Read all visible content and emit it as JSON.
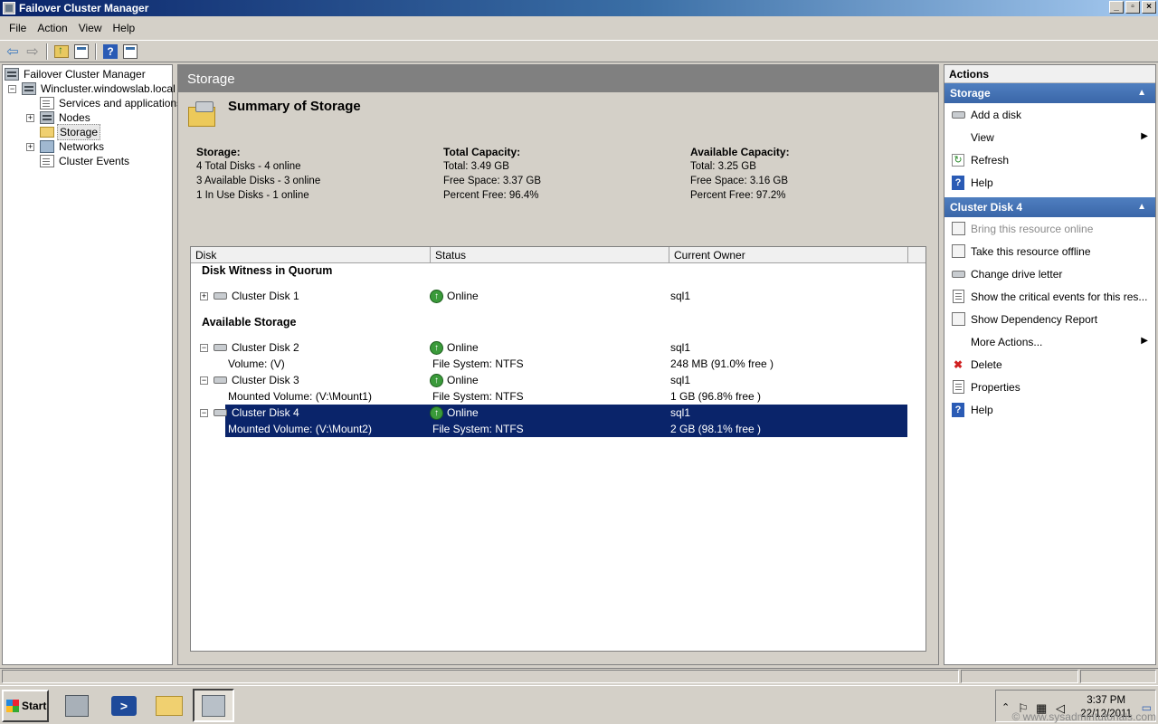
{
  "window": {
    "title": "Failover Cluster Manager",
    "controls": [
      "_",
      "▫",
      "×"
    ]
  },
  "menu": [
    "File",
    "Action",
    "View",
    "Help"
  ],
  "tree": {
    "root": "Failover Cluster Manager",
    "cluster": "Wincluster.windowslab.local",
    "items": [
      "Services and applications",
      "Nodes",
      "Storage",
      "Networks",
      "Cluster Events"
    ],
    "selected": "Storage"
  },
  "center": {
    "header": "Storage",
    "summary_title": "Summary of Storage",
    "storage": {
      "heading": "Storage:",
      "lines": [
        "4 Total Disks - 4 online",
        "3 Available Disks - 3 online",
        "1 In Use Disks - 1 online"
      ]
    },
    "total": {
      "heading": "Total Capacity:",
      "lines": [
        "Total: 3.49 GB",
        "Free Space: 3.37 GB",
        "Percent Free: 96.4%"
      ]
    },
    "available": {
      "heading": "Available Capacity:",
      "lines": [
        "Total: 3.25 GB",
        "Free Space: 3.16 GB",
        "Percent Free: 97.2%"
      ]
    },
    "columns": [
      "Disk",
      "Status",
      "Current Owner"
    ],
    "groups": [
      "Disk Witness in Quorum",
      "Available Storage"
    ],
    "rows": [
      {
        "disk": "Cluster Disk 1",
        "status": "Online",
        "owner": "sql1"
      },
      {
        "disk": "Cluster Disk 2",
        "status": "Online",
        "owner": "sql1"
      },
      {
        "disk": "Volume: (V)",
        "status": "File System: NTFS",
        "owner": "248 MB (91.0% free )"
      },
      {
        "disk": "Cluster Disk 3",
        "status": "Online",
        "owner": "sql1"
      },
      {
        "disk": "Mounted Volume: (V:\\Mount1)",
        "status": "File System: NTFS",
        "owner": "1 GB (96.8% free )"
      },
      {
        "disk": "Cluster Disk 4",
        "status": "Online",
        "owner": "sql1"
      },
      {
        "disk": "Mounted Volume: (V:\\Mount2)",
        "status": "File System: NTFS",
        "owner": "2 GB (98.1% free )"
      }
    ]
  },
  "actions": {
    "title": "Actions",
    "storage_section": "Storage",
    "storage_items": [
      "Add a disk",
      "View",
      "Refresh",
      "Help"
    ],
    "disk_section": "Cluster Disk 4",
    "disk_items": [
      "Bring this resource online",
      "Take this resource offline",
      "Change drive letter",
      "Show the critical events for this res...",
      "Show Dependency Report",
      "More Actions...",
      "Delete",
      "Properties",
      "Help"
    ]
  },
  "taskbar": {
    "start": "Start",
    "time": "3:37 PM",
    "date": "22/12/2011",
    "watermark": "© www.sysadmintutorials.com"
  },
  "colors": {
    "selection": "#0a246a",
    "section_header": "#4f7fc0",
    "online": "#3a9a3a"
  }
}
